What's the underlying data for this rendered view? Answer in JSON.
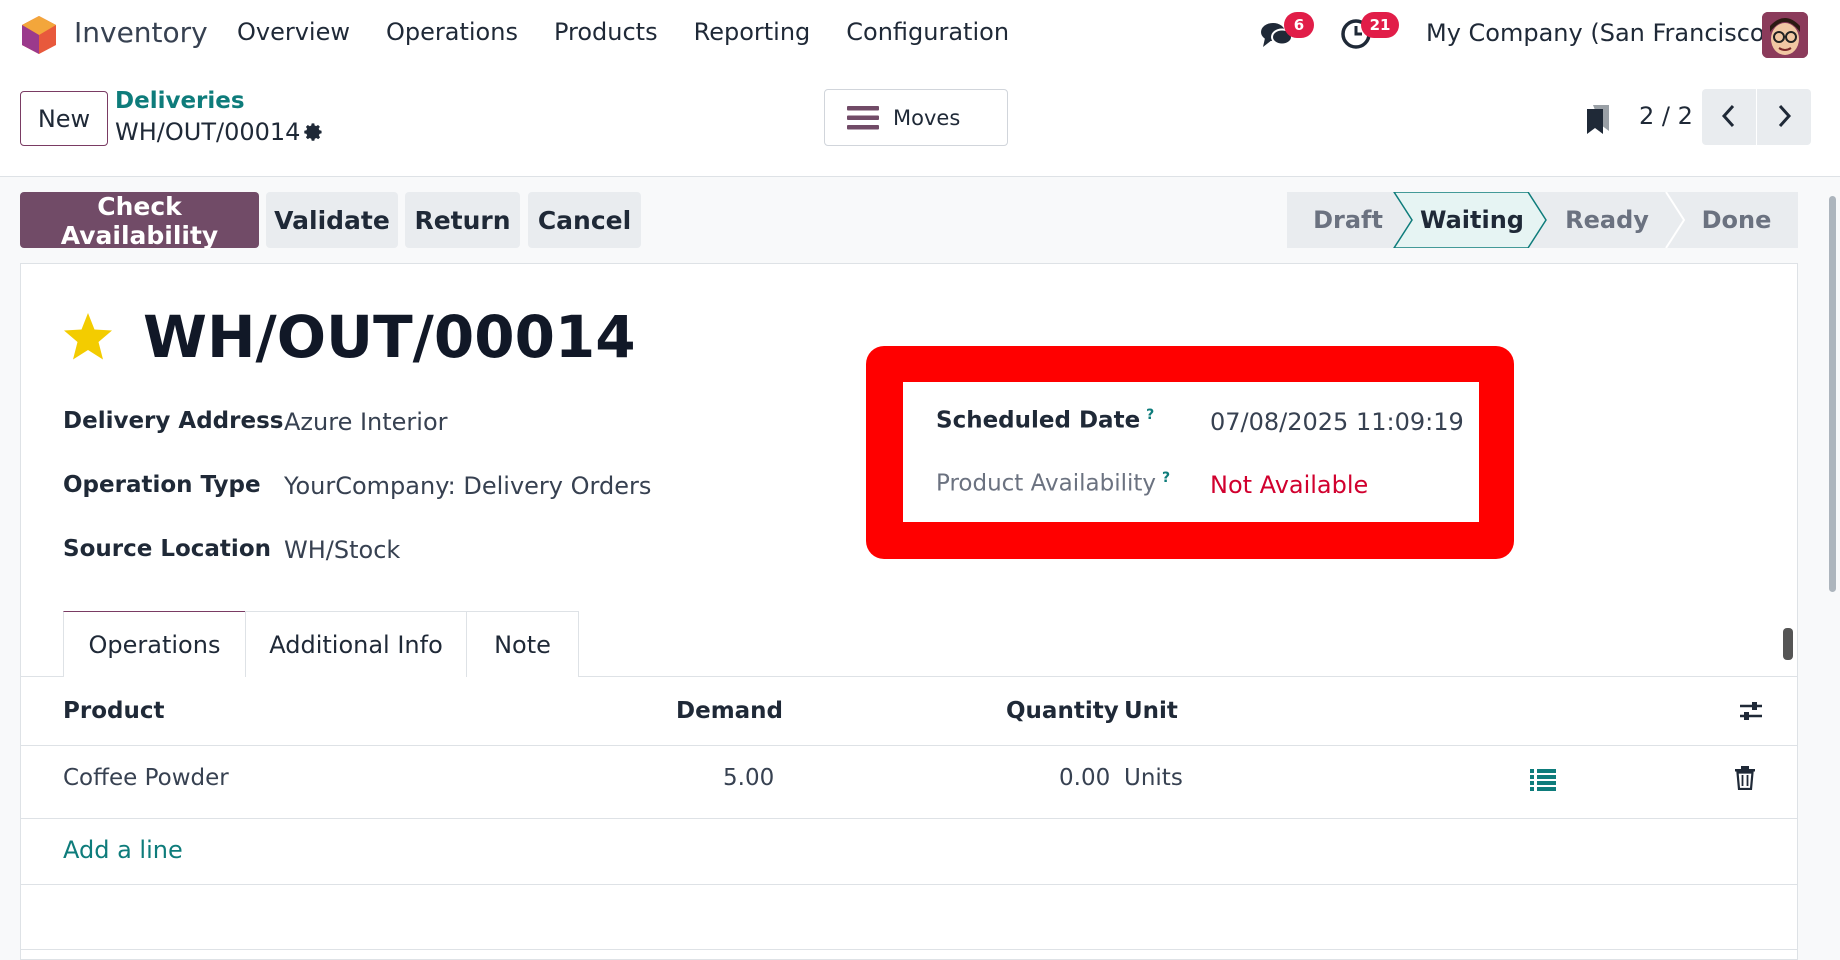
{
  "navbar": {
    "app_name": "Inventory",
    "menu": [
      "Overview",
      "Operations",
      "Products",
      "Reporting",
      "Configuration"
    ],
    "messages_count": "6",
    "activities_count": "21",
    "company": "My Company (San Francisco)"
  },
  "control_panel": {
    "new_label": "New",
    "breadcrumb": "Deliveries",
    "record_name": "WH/OUT/00014",
    "moves_label": "Moves",
    "pager": "2 / 2"
  },
  "actions": {
    "check_availability": "Check Availability",
    "validate": "Validate",
    "return": "Return",
    "cancel": "Cancel"
  },
  "stages": {
    "items": [
      "Draft",
      "Waiting",
      "Ready",
      "Done"
    ],
    "active": "Waiting"
  },
  "form": {
    "title": "WH/OUT/00014",
    "delivery_address_label": "Delivery Address",
    "delivery_address": "Azure Interior",
    "operation_type_label": "Operation Type",
    "operation_type": "YourCompany: Delivery Orders",
    "source_location_label": "Source Location",
    "source_location": "WH/Stock",
    "scheduled_date_label": "Scheduled Date",
    "scheduled_date": "07/08/2025 11:09:19",
    "availability_label": "Product Availability",
    "availability": "Not Available",
    "help_mark": "?"
  },
  "tabs": [
    "Operations",
    "Additional Info",
    "Note"
  ],
  "table": {
    "headers": {
      "product": "Product",
      "demand": "Demand",
      "quantity": "Quantity",
      "unit": "Unit"
    },
    "rows": [
      {
        "product": "Coffee Powder",
        "demand": "5.00",
        "quantity": "0.00",
        "unit": "Units"
      }
    ],
    "add_line": "Add a line"
  },
  "colors": {
    "primary": "#714b67",
    "link": "#0e7c7b",
    "danger": "#d1002e",
    "highlight": "#ff0000"
  }
}
